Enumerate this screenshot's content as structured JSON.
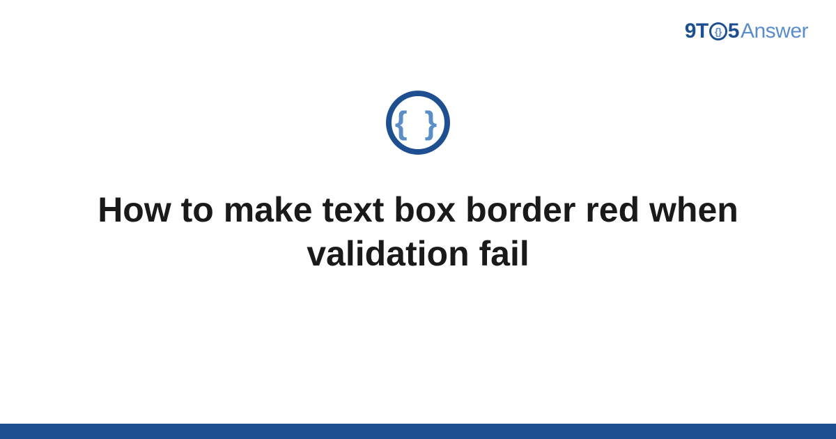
{
  "logo": {
    "part1": "9T",
    "part2": "5",
    "part3": "Answer"
  },
  "icon": {
    "name": "code-braces",
    "glyph": "{ }"
  },
  "title": "How to make text box border red when validation fail",
  "colors": {
    "primary": "#1d4f91",
    "secondary": "#5b8dc9"
  }
}
